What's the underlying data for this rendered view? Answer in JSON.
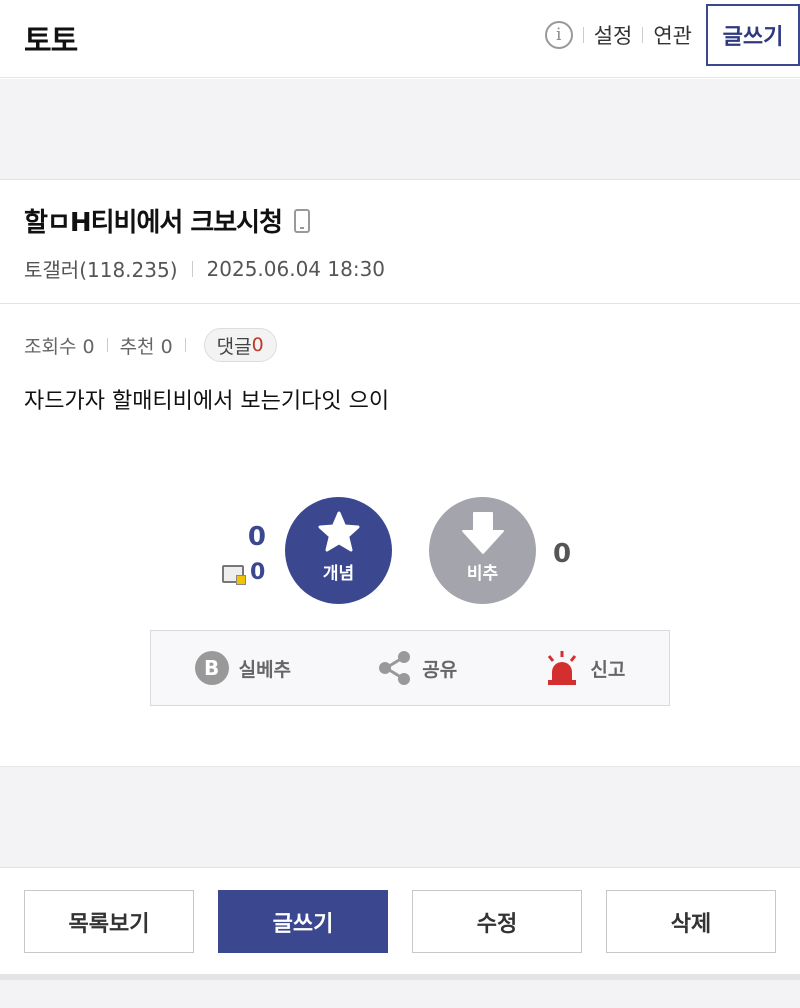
{
  "header": {
    "title": "토토",
    "info_icon": "i",
    "links": [
      "설정",
      "연관"
    ],
    "write_label": "글쓰기"
  },
  "post": {
    "title": "할ㅁH티비에서 크보시청",
    "author": "토갤러(118.235)",
    "date": "2025.06.04 18:30",
    "views_label": "조회수 0",
    "recommend_label": "추천 0",
    "comment_label": "댓글",
    "comment_count": "0",
    "body": "자드가자 할매티비에서 보는기다잇 으이"
  },
  "votes": {
    "up_count": "0",
    "fix_count": "0",
    "up_label": "개념",
    "down_label": "비추",
    "down_count": "0"
  },
  "actions": {
    "best": "실베추",
    "best_icon_letter": "B",
    "share": "공유",
    "report": "신고"
  },
  "buttons": {
    "list": "목록보기",
    "write": "글쓰기",
    "edit": "수정",
    "delete": "삭제"
  },
  "colors": {
    "accent": "#3b4890",
    "down": "#a4a4ac",
    "comment_count": "#c0392b",
    "report": "#d32f2f"
  }
}
